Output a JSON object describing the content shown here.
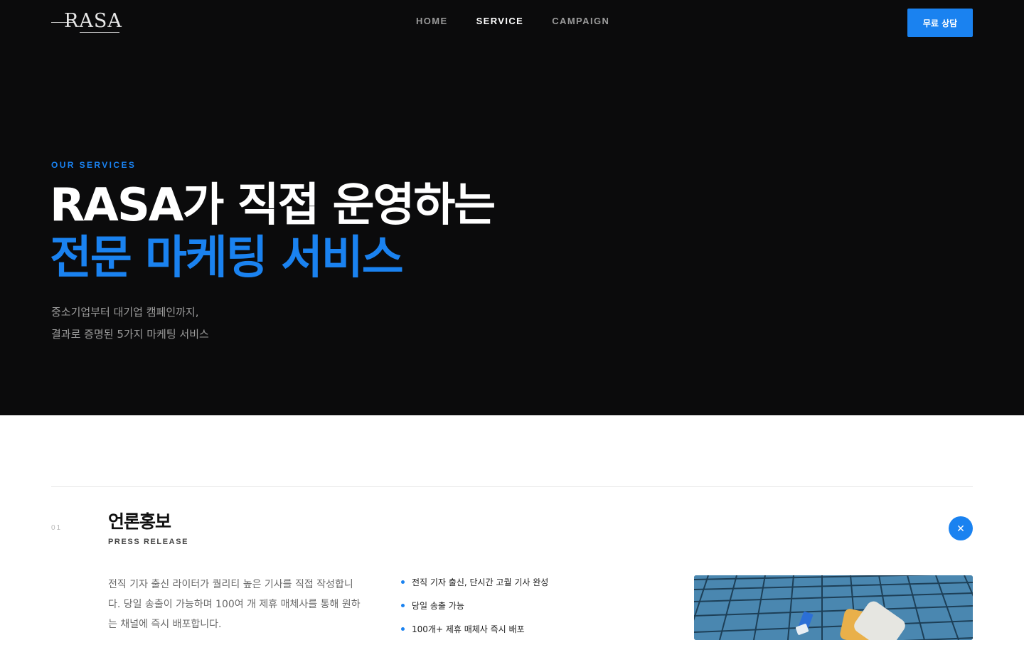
{
  "nav": {
    "logo_text": "RASA",
    "menu": [
      {
        "label": "HOME",
        "active": false
      },
      {
        "label": "SERVICE",
        "active": true
      },
      {
        "label": "CAMPAIGN",
        "active": false
      }
    ],
    "cta_label": "무료 상담"
  },
  "hero": {
    "eyebrow": "OUR SERVICES",
    "headline_line1": "RASA가 직접 운영하는",
    "headline_line2": "전문 마케팅 서비스",
    "desc_line1": "중소기업부터 대기업 캠페인까지,",
    "desc_line2": "결과로 증명된 5가지 마케팅 서비스"
  },
  "service": {
    "number": "01",
    "title": "언론홍보",
    "subtitle": "PRESS RELEASE",
    "close_icon": "close-icon",
    "description": "전직 기자 출신 라이터가 퀄리티 높은 기사를 직접 작성합니다. 당일 송출이 가능하며 100여 개 제휴 매체사를 통해 원하는 채널에 즉시 배포합니다.",
    "features": [
      "전직 기자 출신, 단시간 고퀄 기사 완성",
      "당일 송출 가능",
      "100개+ 제휴 매체사 즉시 배포"
    ]
  },
  "colors": {
    "accent": "#1a82f0",
    "hero_bg": "#0b0b0c",
    "image_bg": "#3f7faa"
  }
}
